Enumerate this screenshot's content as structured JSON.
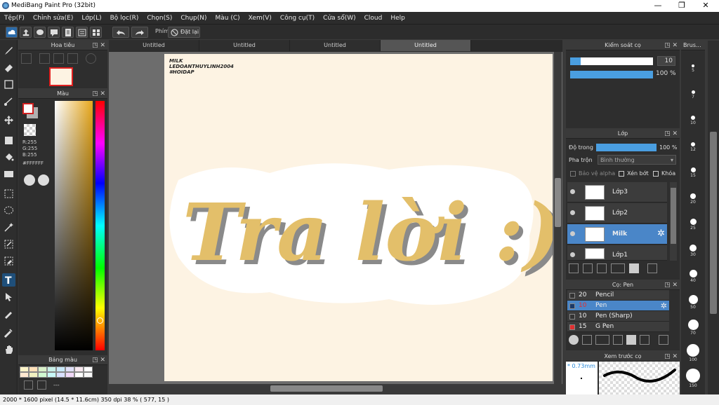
{
  "window": {
    "title": "MediBang Paint Pro (32bit)",
    "min": "—",
    "max": "❐",
    "close": "✕"
  },
  "menu": [
    "Tệp(F)",
    "Chỉnh sửa(E)",
    "Lớp(L)",
    "Bộ lọc(R)",
    "Chọn(S)",
    "Chụp(N)",
    "Màu (C)",
    "Xem(V)",
    "Công cụ(T)",
    "Cửa sổ(W)",
    "Cloud",
    "Help"
  ],
  "toolbar": {
    "key_label": "Phím",
    "reset_label": "Đặt lại"
  },
  "tabs": [
    "Untitled",
    "Untitled",
    "Untitled",
    "Untitled"
  ],
  "navigator": {
    "title": "Hoa tiêu"
  },
  "color_panel": {
    "title": "Màu",
    "r": "R:255",
    "g": "G:255",
    "b": "B:255",
    "hex": "#FFFFFF",
    "primary": "#ffffff",
    "secondary": "#b0b0b0"
  },
  "palette": {
    "title": "Bảng màu",
    "dash": "---",
    "swatches": [
      "#fff4c8",
      "#ffe0b8",
      "#d8f0c8",
      "#c8f0e8",
      "#c8e8f8",
      "#e0e0f8",
      "#f8e8f0",
      "#ffffff",
      "#ffe8d0",
      "#f0f0c0",
      "#d0f8d0",
      "#c8f8f8",
      "#d8e0ff",
      "#f0d8f8",
      "#ffffff",
      "#f8f8f8"
    ]
  },
  "canvas": {
    "note_lines": [
      "MILK",
      "LEDOANTHUYLINH2004",
      "#HOIDAP"
    ],
    "art_text": "Tra lời :)",
    "art_color": "#e3bf6a",
    "shadow_color": "#8a8a8a",
    "bg": "#fdf3e3"
  },
  "brush_control": {
    "title": "Kiểm soát cọ",
    "size": "10",
    "opacity": "100 %",
    "size_level": 0.13,
    "opacity_level": 1.0
  },
  "layers": {
    "title": "Lớp",
    "opacity_label": "Độ trong",
    "opacity_value": "100 %",
    "blend_label": "Pha trộn",
    "blend_value": "Bình thường",
    "protect_alpha": "Bảo vệ alpha",
    "clip": "Xén bớt",
    "lock": "Khóa",
    "items": [
      {
        "name": "Lớp3",
        "selected": false
      },
      {
        "name": "Lớp2",
        "selected": false
      },
      {
        "name": "Milk",
        "selected": true
      },
      {
        "name": "Lớp1",
        "selected": false
      }
    ]
  },
  "brushes": {
    "title": "Cọ: Pen",
    "items": [
      {
        "size": "20",
        "name": "Pencil",
        "swatch": "#333333",
        "selected": false
      },
      {
        "size": "10",
        "name": "Pen",
        "swatch": "#1a3a6a",
        "selected": true
      },
      {
        "size": "10",
        "name": "Pen (Sharp)",
        "swatch": "#333333",
        "selected": false
      },
      {
        "size": "15",
        "name": "G Pen",
        "swatch": "#e03030",
        "selected": false
      }
    ]
  },
  "preview": {
    "title": "Xem trước cọ",
    "size": "* 0.73mm"
  },
  "brush_sizes": {
    "title": "Brus...",
    "sizes": [
      "5",
      "7",
      "10",
      "12",
      "15",
      "20",
      "25",
      "30",
      "40",
      "50",
      "70",
      "100",
      "150"
    ]
  },
  "status": {
    "text": "2000 * 1600 pixel   (14.5 * 11.6cm)   350 dpi   38 %   ( 577, 15 )"
  }
}
